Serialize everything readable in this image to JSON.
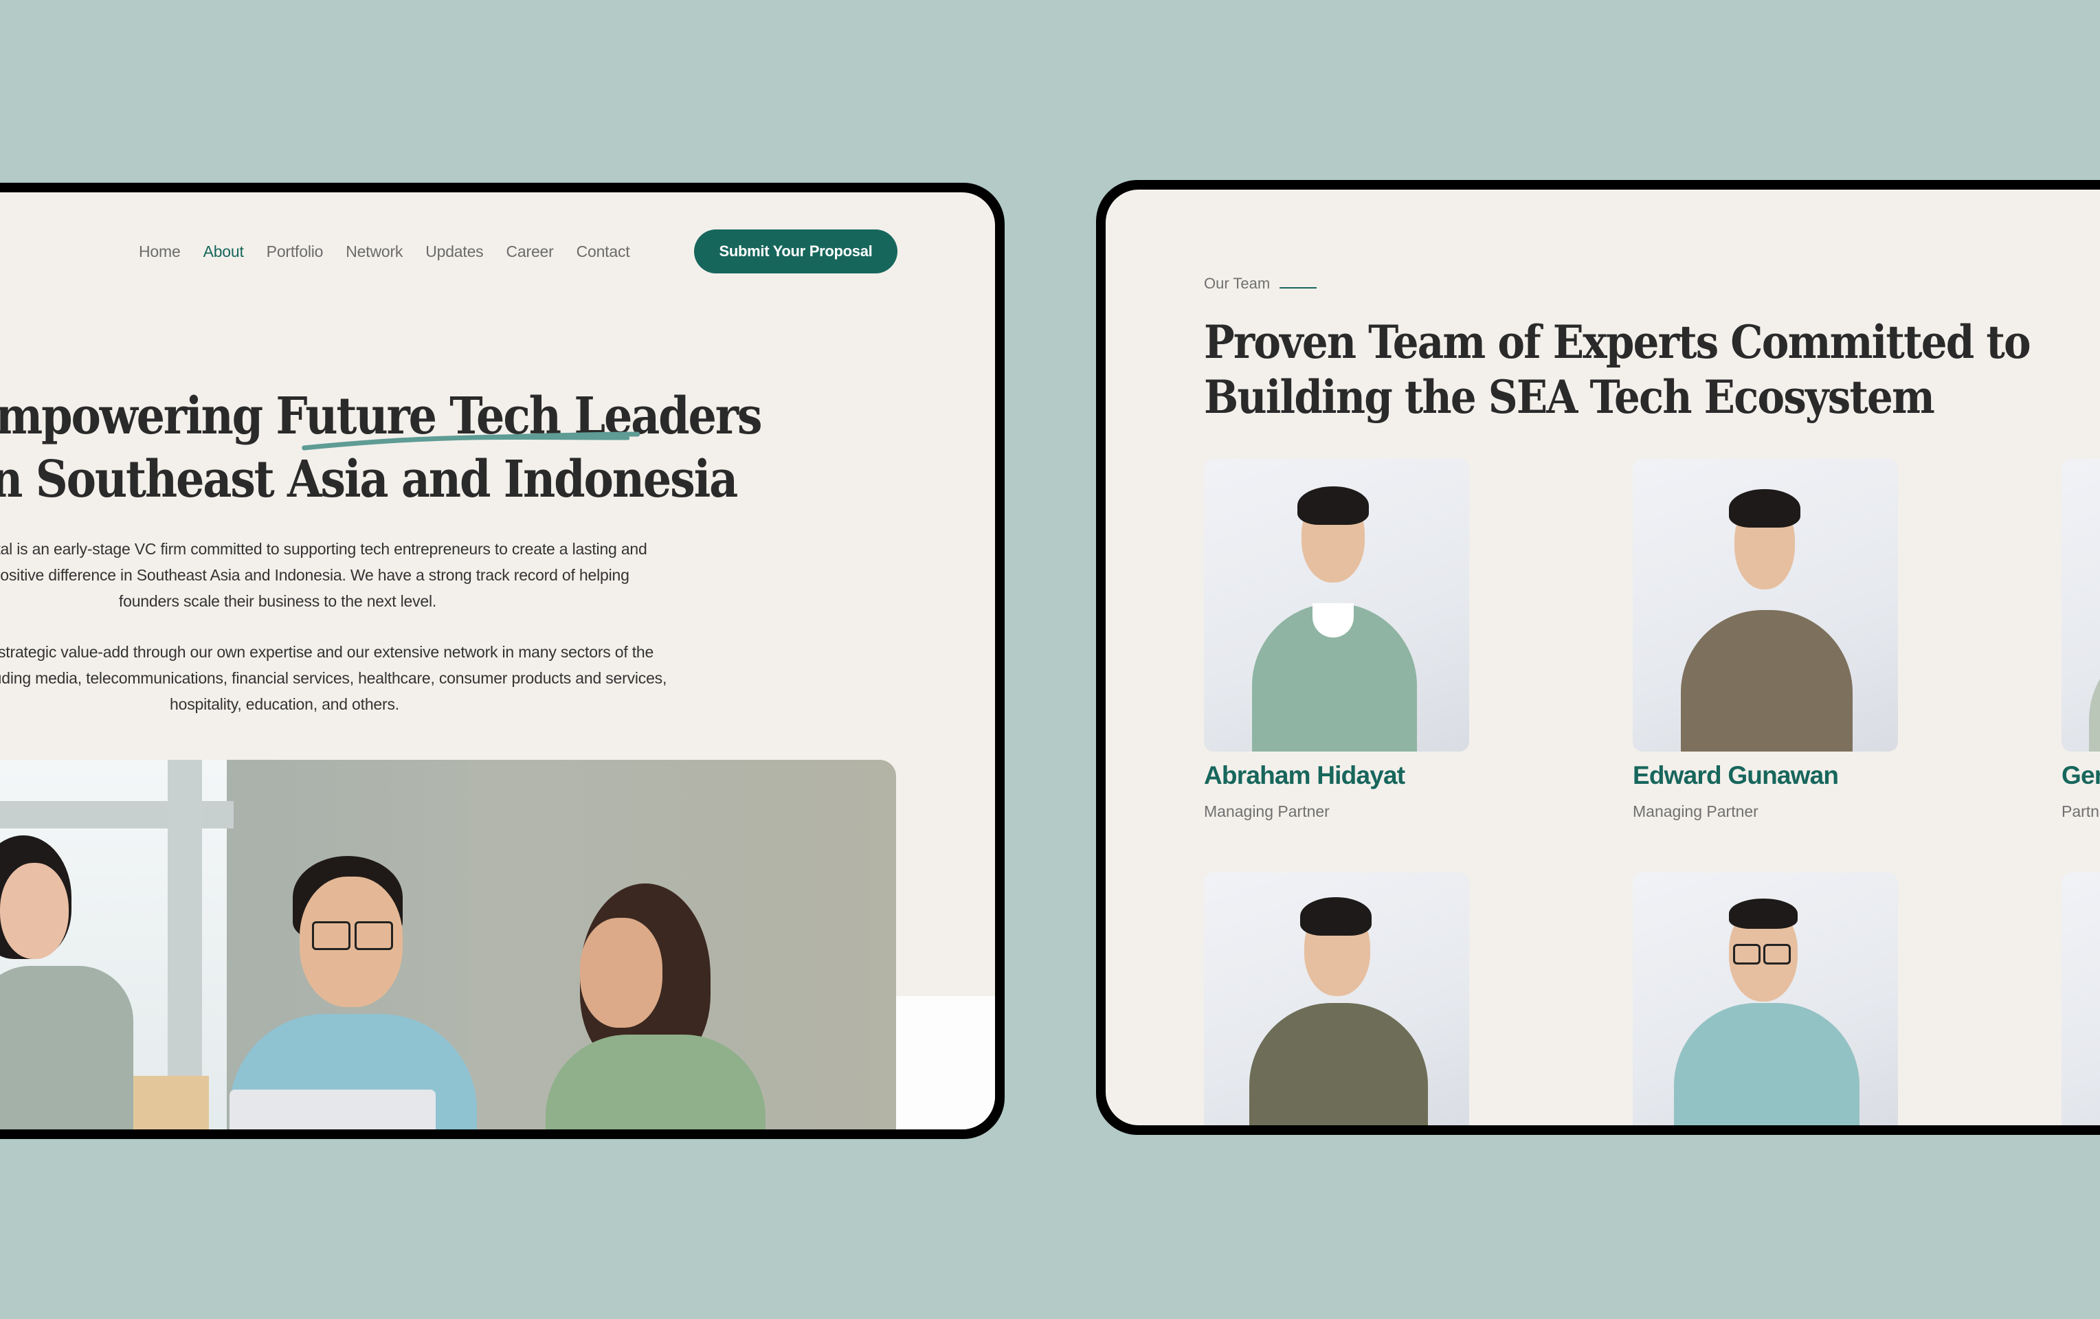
{
  "left_screen": {
    "nav": {
      "links": [
        {
          "label": "Home",
          "active": false
        },
        {
          "label": "About",
          "active": true
        },
        {
          "label": "Portfolio",
          "active": false
        },
        {
          "label": "Network",
          "active": false
        },
        {
          "label": "Updates",
          "active": false
        },
        {
          "label": "Career",
          "active": false
        },
        {
          "label": "Contact",
          "active": false
        }
      ],
      "cta_label": "Submit Your Proposal"
    },
    "hero": {
      "title_line1_prefix": "Empowering ",
      "title_line1_highlight": "Future Tech Leaders",
      "title_line2": "in Southeast Asia and Indonesia",
      "paragraph1": "Skystar Capital is an early-stage VC firm committed to supporting tech entrepreneurs to create a lasting and profound positive difference in Southeast Asia and Indonesia. We have a strong track record of helping founders scale their business to the next level.",
      "paragraph2": "We provide strategic value-add through our own expertise and our extensive network in many sectors of the economy including media, telecommunications, financial services, healthcare, consumer products and services, hospitality, education, and others.",
      "image_alt": "team-meeting-photo"
    }
  },
  "right_screen": {
    "eyebrow": "Our Team",
    "title_line1": "Proven Team of Experts Committed to",
    "title_line2": "Building the SEA Tech Ecosystem",
    "team": [
      {
        "name": "Abraham Hidayat",
        "role": "Managing Partner"
      },
      {
        "name": "Edward Gunawan",
        "role": "Managing Partner"
      },
      {
        "name": "Gen",
        "role": "Partn"
      },
      {
        "name": "",
        "role": ""
      },
      {
        "name": "",
        "role": ""
      },
      {
        "name": "",
        "role": ""
      }
    ]
  },
  "colors": {
    "background": "#b3cac7",
    "page_bg": "#f3f0eb",
    "accent": "#17665c",
    "underline_stroke": "#5e9c95",
    "heading_text": "#2a2a2a",
    "body_text": "#333333",
    "muted_text": "#707070"
  }
}
